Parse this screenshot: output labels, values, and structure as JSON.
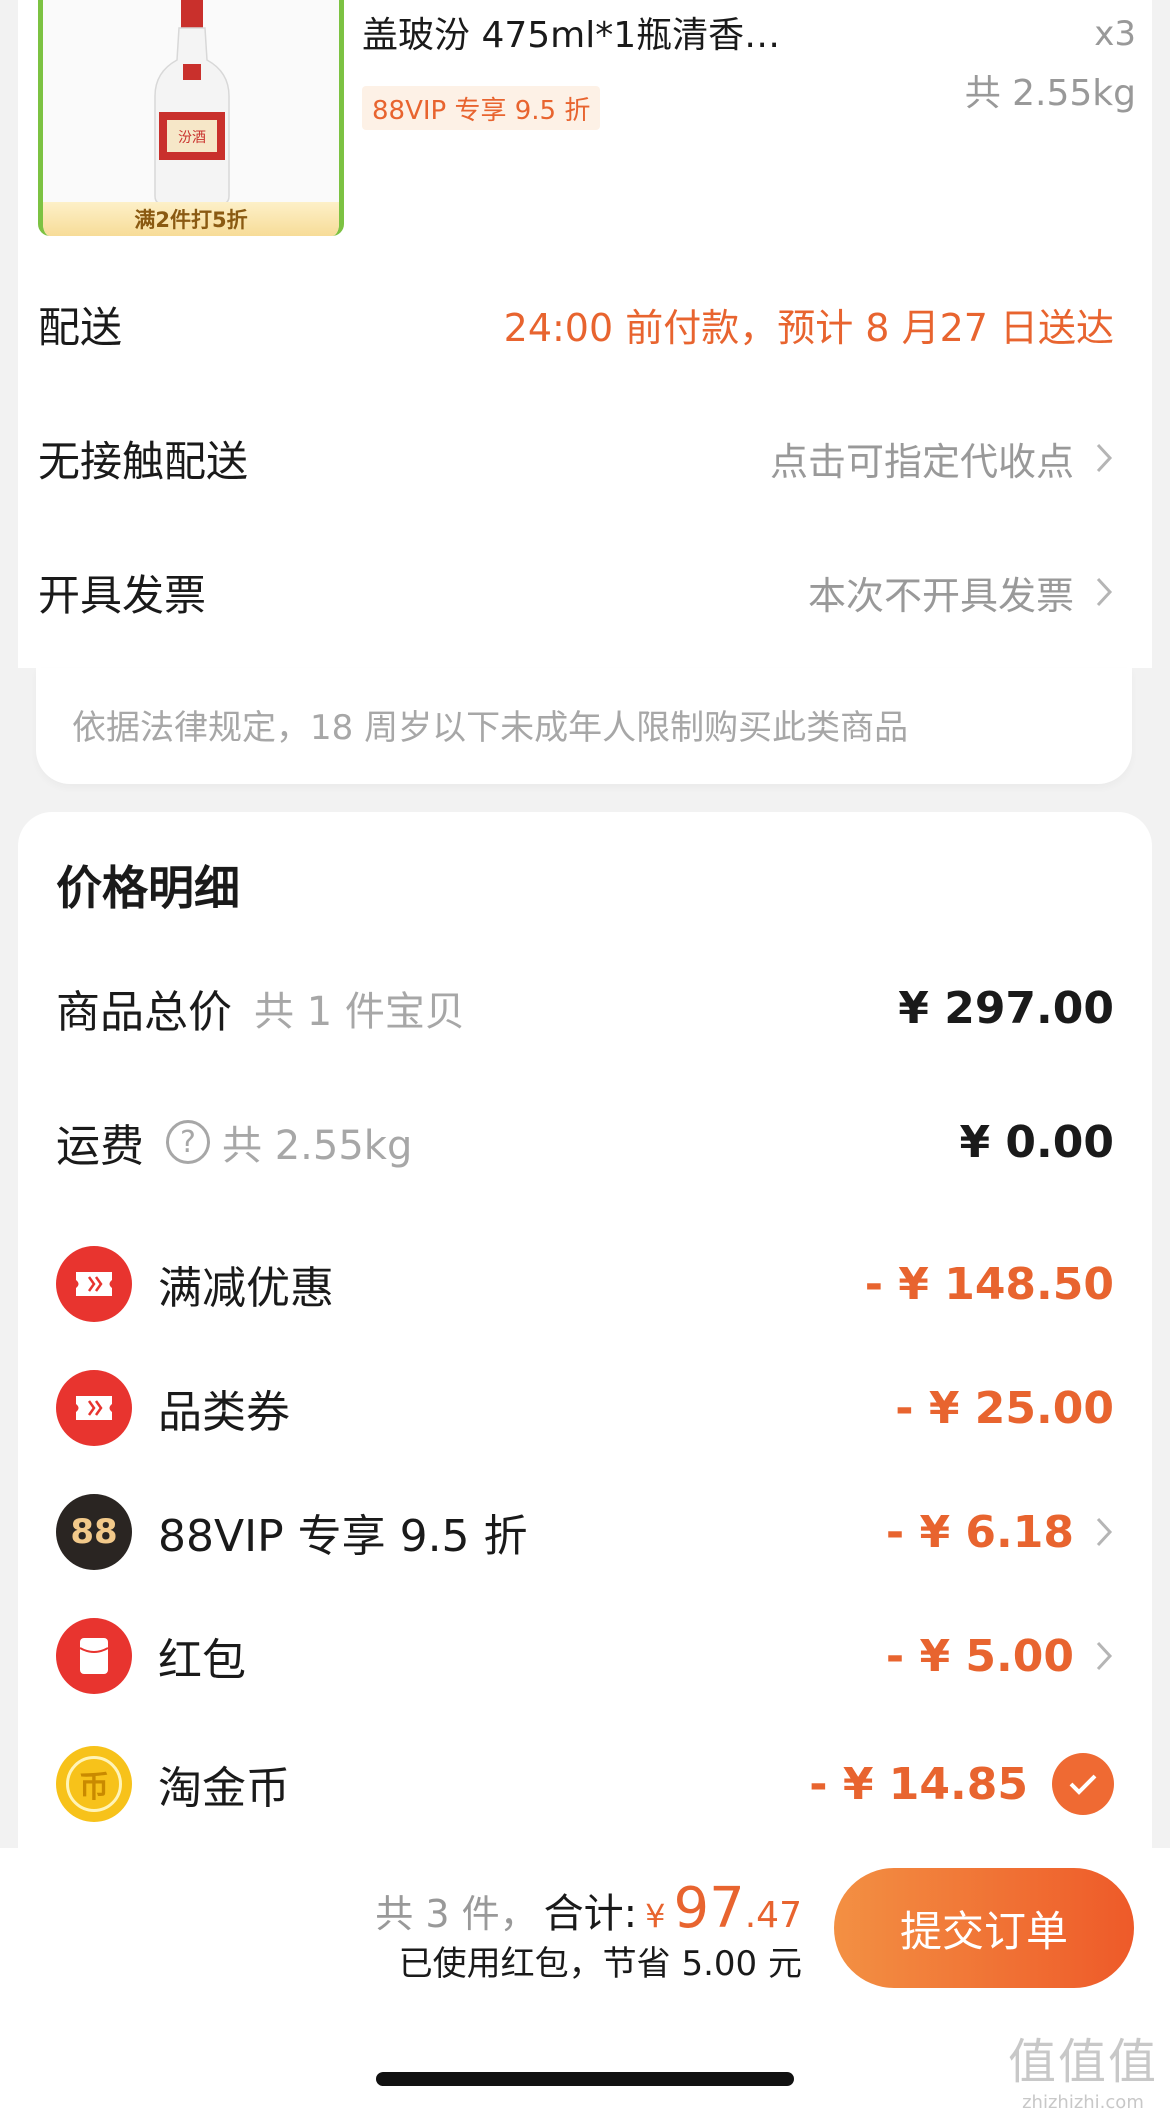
{
  "product": {
    "title": "盖玻汾 475ml*1瓶清香…",
    "vip_tag": "88VIP 专享 9.5 折",
    "promo_strip": "满2件打5折",
    "quantity": "x3",
    "weight": "共 2.55kg",
    "bottle_label": "汾酒"
  },
  "delivery": {
    "label": "配送",
    "value": "24:00 前付款，预计 8 月27 日送达",
    "value_color": "#e8642f"
  },
  "contactless": {
    "label": "无接触配送",
    "value": "点击可指定代收点"
  },
  "invoice": {
    "label": "开具发票",
    "value": "本次不开具发票"
  },
  "notice": "依据法律规定，18 周岁以下未成年人限制购买此类商品",
  "price_detail": {
    "title": "价格明细",
    "rows": [
      {
        "label": "商品总价",
        "sub": "共 1 件宝贝",
        "amount": "¥ 297.00"
      },
      {
        "label": "运费",
        "sub": "共 2.55kg",
        "amount": "¥ 0.00",
        "help_icon": "?"
      },
      {
        "label": "满减优惠",
        "amount": "- ¥ 148.50",
        "icon": "coupon-icon"
      },
      {
        "label": "品类券",
        "amount": "- ¥ 25.00",
        "icon": "coupon-icon"
      },
      {
        "label": "88VIP 专享 9.5 折",
        "amount": "- ¥ 6.18",
        "icon": "vip88-icon",
        "icon_text": "88"
      },
      {
        "label": "红包",
        "amount": "- ¥ 5.00",
        "icon": "red-envelope-icon",
        "icon_text": "¥"
      },
      {
        "label": "淘金币",
        "amount": "- ¥ 14.85",
        "icon": "gold-coin-icon",
        "icon_text": "币",
        "checked": true
      }
    ]
  },
  "footer": {
    "count": "共 3 件，",
    "total_label": "合计:",
    "currency": "¥",
    "total_int": "97",
    "total_dec": ".47",
    "saved_text": "已使用红包，节省 5.00 元",
    "submit_label": "提交订单"
  },
  "watermark": {
    "main": "值值值",
    "sub": "zhizhizhi.com"
  },
  "colors": {
    "accent": "#e8642f",
    "icon_red": "#e8342f",
    "icon_dark": "#2a2522",
    "icon_gold": "#f7c21a",
    "button_gradient_start": "#f39043",
    "button_gradient_end": "#ee5a29"
  }
}
